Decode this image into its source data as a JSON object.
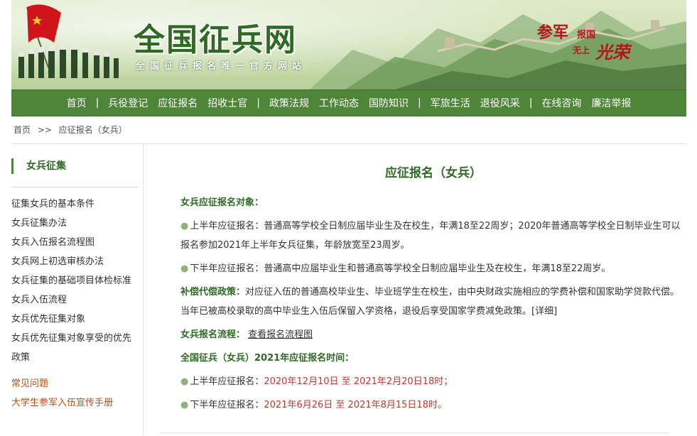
{
  "banner": {
    "title": "全国征兵网",
    "subtitle": "全国征兵报名唯一官方网站",
    "slogan_a": "参军",
    "slogan_b": "报国",
    "slogan_c": "无上",
    "slogan_d": "光荣"
  },
  "nav": {
    "items": [
      {
        "label": "首页",
        "sep": "|"
      },
      {
        "label": "兵役登记",
        "sep": ""
      },
      {
        "label": "应征报名",
        "sep": ""
      },
      {
        "label": "招收士官",
        "sep": "|"
      },
      {
        "label": "政策法规",
        "sep": ""
      },
      {
        "label": "工作动态",
        "sep": ""
      },
      {
        "label": "国防知识",
        "sep": "|"
      },
      {
        "label": "军旅生活",
        "sep": ""
      },
      {
        "label": "退役风采",
        "sep": "|"
      },
      {
        "label": "在线咨询",
        "sep": ""
      },
      {
        "label": "廉洁举报",
        "sep": ""
      }
    ]
  },
  "breadcrumb": {
    "home": "首页",
    "sep": ">>",
    "current": "应征报名（女兵）"
  },
  "sidebar": {
    "heading": "女兵征集",
    "items": [
      "征集女兵的基本条件",
      "女兵征集办法",
      "女兵入伍报名流程图",
      "女兵网上初选审核办法",
      "女兵征集的基础项目体检标准",
      "女兵入伍流程",
      "女兵优先征集对象",
      "女兵优先征集对象享受的优先政策"
    ],
    "footer_items": [
      "常见问题",
      "大学生参军入伍宣传手册"
    ]
  },
  "content": {
    "title": "应征报名（女兵）",
    "target_label": "女兵应征报名对象：",
    "bullet": "●",
    "first_half": "上半年应征报名：普通高等学校全日制应届毕业生及在校生，年满18至22周岁；2020年普通高等学校全日制毕业生可以报名参加2021年上半年女兵征集，年龄放宽至23周岁。",
    "second_half": "下半年应征报名：普通高中应届毕业生和普通高等学校全日制应届毕业生及在校生，年满18至22周岁。",
    "policy_label": "补偿代偿政策：",
    "policy_text": "对应征入伍的普通高校毕业生、毕业班学生在校生，由中央财政实施相应的学费补偿和国家助学贷款代偿。当年已被高校录取的高中毕业生入伍后保留入学资格，退役后享受国家学费减免政策。",
    "detail_link": "[详细]",
    "process_label": "女兵报名流程：",
    "process_link": "查看报名流程图",
    "time_label": "全国征兵（女兵）2021年应征报名时间：",
    "time1_prefix": "上半年应征报名：",
    "time1_value": "2020年12月10日 至 2021年2月20日18时；",
    "time2_prefix": "下半年应征报名：",
    "time2_value": "2021年6月26日 至 2021年8月15日18时。"
  },
  "colors": {
    "brand_green": "#4e8539",
    "title_green": "#2f6a25",
    "accent_red": "#c0392b"
  }
}
